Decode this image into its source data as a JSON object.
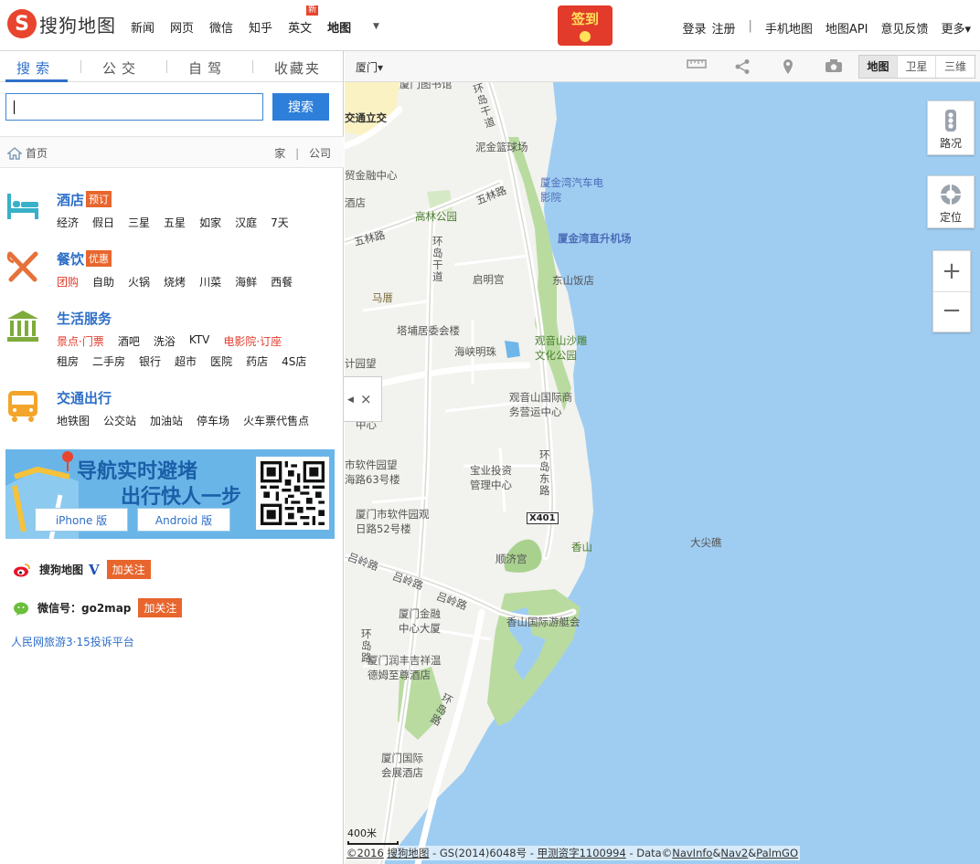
{
  "header": {
    "logo_glyph": "S",
    "logo_text": "搜狗地图",
    "nav": [
      {
        "label": "新闻"
      },
      {
        "label": "网页"
      },
      {
        "label": "微信"
      },
      {
        "label": "知乎"
      },
      {
        "label": "英文",
        "badge": "新"
      },
      {
        "label": "地图",
        "current": true
      }
    ],
    "more_caret": "▼",
    "signin_promo": "签到",
    "right": {
      "login": "登录",
      "register": "注册",
      "sep": "|",
      "mobile_map": "手机地图",
      "map_api": "地图API",
      "feedback": "意见反馈",
      "more": "更多▾"
    }
  },
  "sidebar": {
    "tabs": [
      "搜索",
      "公交",
      "自驾",
      "收藏夹"
    ],
    "active_tab": 0,
    "search_value": "",
    "search_button": "搜索",
    "home_label": "首页",
    "shortcut_home": "家",
    "shortcut_sep": "|",
    "shortcut_company": "公司",
    "categories": [
      {
        "title": "酒店",
        "tag": "预订",
        "icon": "bed-icon",
        "rows": [
          [
            "经济",
            "假日",
            "三星",
            "五星",
            "如家",
            "汉庭",
            "7天"
          ]
        ]
      },
      {
        "title": "餐饮",
        "tag": "优惠",
        "icon": "fork-knife-icon",
        "rows": [
          [
            "团购",
            "自助",
            "火锅",
            "烧烤",
            "川菜",
            "海鲜",
            "西餐"
          ]
        ]
      },
      {
        "title": "生活服务",
        "tag": "",
        "icon": "bank-icon",
        "rows": [
          [
            "景点·门票",
            "酒吧",
            "洗浴",
            "KTV",
            "电影院·订座"
          ],
          [
            "租房",
            "二手房",
            "银行",
            "超市",
            "医院",
            "药店",
            "4S店"
          ]
        ]
      },
      {
        "title": "交通出行",
        "tag": "",
        "icon": "bus-icon",
        "rows": [
          [
            "地铁图",
            "公交站",
            "加油站",
            "停车场",
            "火车票代售点"
          ]
        ]
      }
    ],
    "banner": {
      "line1": "导航实时避堵",
      "line2": "出行快人一步",
      "iphone": "iPhone 版",
      "android": "Android 版"
    },
    "weibo": {
      "name": "搜狗地图",
      "verified": "V",
      "follow": "加关注"
    },
    "wechat": {
      "name": "微信号：go2map",
      "follow": "加关注"
    },
    "complaint_link": "人民网旅游3·15投诉平台"
  },
  "map_toolbar": {
    "city": "厦门▾",
    "tools": [
      "ruler-icon",
      "share-icon",
      "pin-icon",
      "camera-icon"
    ],
    "types": [
      "地图",
      "卫星",
      "三维"
    ],
    "active_type": 0
  },
  "map": {
    "labels": [
      "厦门图书馆",
      "交通立交",
      "泥金篮球场",
      "贸金融中心",
      "酒店",
      "厦金湾汽车电影院",
      "高林公园",
      "五林路",
      "五林路",
      "厦金湾直升机场",
      "启明宫",
      "东山饭店",
      "马厝",
      "塔埔居委会楼",
      "海峡明珠",
      "观音山沙雕文化公园",
      "计园望",
      "观音山国际商务营运中心",
      "中心",
      "市软件园望",
      "海路63号楼",
      "宝业投资管理中心",
      "厦门市软件园观日路52号楼",
      "X401",
      "顺济宫",
      "香山",
      "大尖礁",
      "吕岭路",
      "吕岭路",
      "吕岭路",
      "厦门金融中心大厦",
      "香山国际游艇会",
      "厦门润丰吉祥温德姆至尊酒店",
      "厦门国际会展酒店",
      "环岛干道",
      "环岛东路",
      "环岛路",
      "环岛路",
      "环岛干道"
    ],
    "traffic": "路况",
    "locate": "定位",
    "zoom_in": "+",
    "zoom_out": "−",
    "scale": "400米",
    "copyright": {
      "year": "©2016",
      "brand": "搜狗地图",
      "gs": " - GS(2014)6048号 - ",
      "survey": "甲测资字1100994",
      "data": " - Data©",
      "navinfo": "NavInfo",
      "amp1": "&",
      "nav2": "Nav2",
      "amp2": "&",
      "palm": "PalmGO"
    },
    "collapse_arrow": "◀",
    "collapse_close": "×"
  },
  "colors": {
    "accent": "#2e6fc8",
    "brand": "#e8442e",
    "tag": "#e8662e",
    "sea": "#9fcdf2",
    "land": "#f2f2ee",
    "green": "#b9dba0"
  }
}
